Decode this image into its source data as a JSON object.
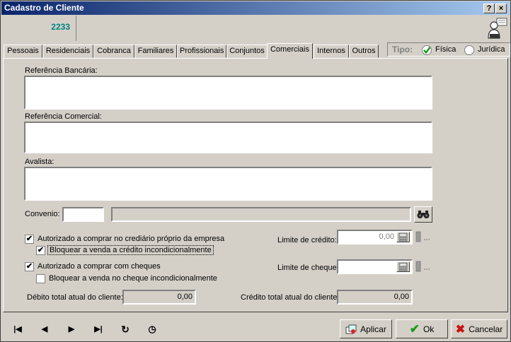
{
  "window": {
    "title": "Cadastro de Cliente",
    "help_glyph": "?",
    "close_glyph": "×"
  },
  "header": {
    "code": "2233"
  },
  "tabs": [
    {
      "label": "Pessoais",
      "active": false
    },
    {
      "label": "Residenciais",
      "active": false
    },
    {
      "label": "Cobranca",
      "active": false
    },
    {
      "label": "Familiares",
      "active": false
    },
    {
      "label": "Profissionais",
      "active": false
    },
    {
      "label": "Conjuntos",
      "active": false
    },
    {
      "label": "Comerciais",
      "active": true
    },
    {
      "label": "Internos",
      "active": false
    },
    {
      "label": "Outros",
      "active": false
    }
  ],
  "tipo": {
    "label": "Tipo:",
    "options": [
      {
        "label": "Física",
        "selected": true
      },
      {
        "label": "Jurídica",
        "selected": false
      }
    ]
  },
  "form": {
    "ref_bancaria_label": "Referência Bancária:",
    "ref_bancaria_value": "",
    "ref_comercial_label": "Referência Comercial:",
    "ref_comercial_value": "",
    "avalista_label": "Avalista:",
    "avalista_value": "",
    "convenio_label": "Convenio:",
    "convenio_code": "",
    "convenio_name": "",
    "search_icon": "binoculars-icon",
    "crediario_label": "Autorizado a comprar no crediário próprio da empresa",
    "crediario_checked": true,
    "bloquear_credito_label": "Bloquear a venda a crédito incondicionalmente",
    "bloquear_credito_checked": true,
    "cheques_label": "Autorizado a comprar com cheques",
    "cheques_checked": true,
    "bloquear_cheque_label": "Bloquear a venda no cheque incondicionalmente",
    "bloquear_cheque_checked": false,
    "limite_credito_label": "Limite de crédito:",
    "limite_credito_value": "0,00",
    "limite_cheque_label": "Limite de cheque:",
    "limite_cheque_value": "",
    "debito_label": "Débito total atual do cliente:",
    "debito_value": "0,00",
    "credito_total_label": "Crédito total atual do cliente:",
    "credito_total_value": "0,00",
    "check_glyph": "✔"
  },
  "nav": {
    "first": "|◀",
    "prev": "◀",
    "next": "▶",
    "last": "▶|",
    "refresh": "↻",
    "history": "◷"
  },
  "buttons": {
    "aplicar": "Aplicar",
    "ok": "Ok",
    "cancelar": "Cancelar",
    "ok_glyph": "✔",
    "cancel_glyph": "✖"
  },
  "colors": {
    "title_start": "#0a246a",
    "title_end": "#a6caf0",
    "code_color": "#008080",
    "ok_green": "#1a9a1a",
    "cancel_red": "#cc1111"
  }
}
